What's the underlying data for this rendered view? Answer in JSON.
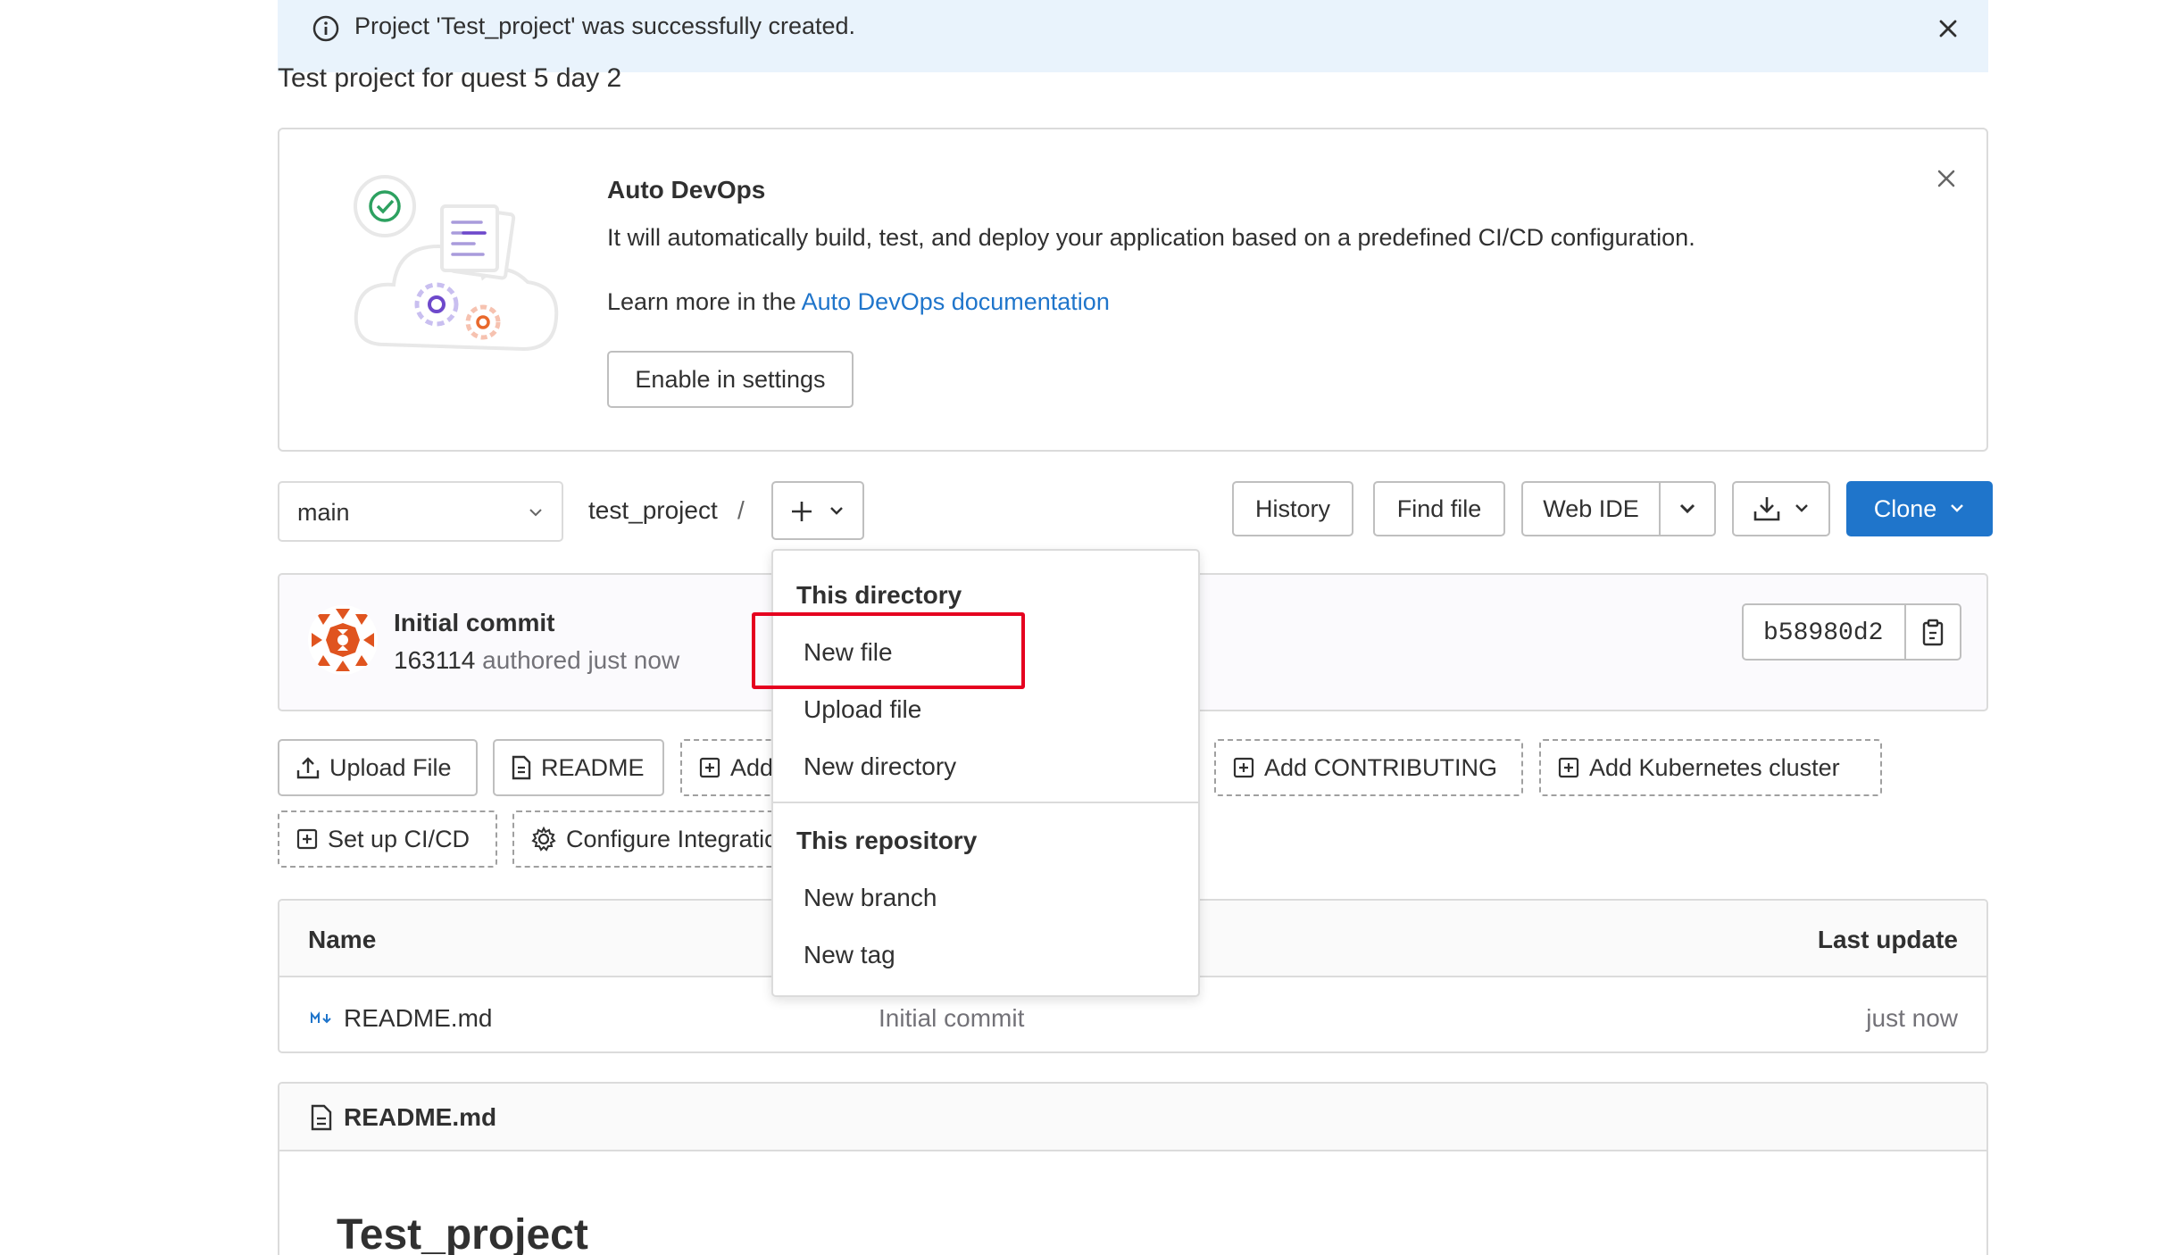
{
  "alert": {
    "message": "Project 'Test_project' was successfully created.",
    "icon": "info-icon",
    "close_icon": "close-icon"
  },
  "project": {
    "description": "Test project for quest 5 day 2"
  },
  "auto_devops": {
    "title": "Auto DevOps",
    "description": "It will automatically build, test, and deploy your application based on a predefined CI/CD configuration.",
    "learn_more_prefix": "Learn more in the ",
    "learn_more_link": "Auto DevOps documentation",
    "enable_button": "Enable in settings"
  },
  "repo_nav": {
    "branch": "main",
    "path": "test_project",
    "path_separator": "/",
    "history": "History",
    "find_file": "Find file",
    "web_ide": "Web IDE",
    "clone": "Clone"
  },
  "commit": {
    "title": "Initial commit",
    "author": "163114",
    "authored": "authored just now",
    "sha": "b58980d2"
  },
  "quick_actions": {
    "upload_file": "Upload File",
    "readme": "README",
    "add_partial": "Add",
    "add_contributing": "Add CONTRIBUTING",
    "add_kubernetes": "Add Kubernetes cluster",
    "setup_cicd": "Set up CI/CD",
    "configure_integrations": "Configure Integrations"
  },
  "file_table": {
    "headers": {
      "name": "Name",
      "last_update": "Last update"
    },
    "rows": [
      {
        "name": "README.md",
        "commit": "Initial commit",
        "updated": "just now"
      }
    ]
  },
  "readme": {
    "filename": "README.md",
    "heading": "Test_project"
  },
  "dropdown": {
    "section_directory": "This directory",
    "new_file": "New file",
    "upload_file": "Upload file",
    "new_directory": "New directory",
    "section_repository": "This repository",
    "new_branch": "New branch",
    "new_tag": "New tag"
  },
  "colors": {
    "primary": "#1f75cb",
    "alert_bg": "#e9f3fc",
    "highlight": "#e5001f"
  }
}
